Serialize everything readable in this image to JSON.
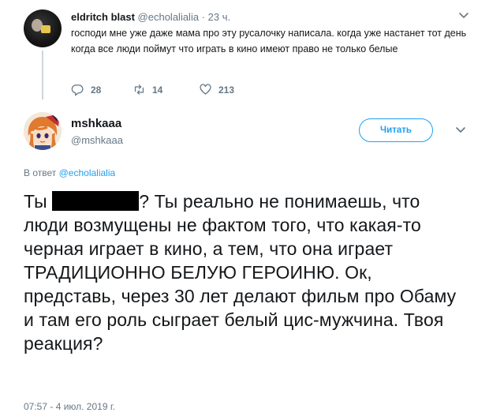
{
  "parent_tweet": {
    "name": "eldritch blast",
    "handle": "@echolalialia",
    "dot": "·",
    "time": "23 ч.",
    "text": "господи мне уже даже мама про эту русалочку написала. когда уже настанет тот день когда все люди поймут что играть в кино имеют право не только белые",
    "actions": {
      "replies": "28",
      "retweets": "14",
      "likes": "213"
    }
  },
  "main_tweet": {
    "name": "mshkaaa",
    "handle": "@mshkaaa",
    "follow_label": "Читать",
    "reply_prefix": "В ответ",
    "reply_to": "@echolalialia",
    "text_before": "Ты",
    "text_after": "? Ты реально не понимаешь, что люди возмущены не фактом того, что какая-то черная играет в кино, а тем, что она играет ТРАДИЦИОННО БЕЛУЮ ГЕРОИНЮ. Ок, представь, через 30 лет делают фильм про Обаму и там его роль сыграет белый цис-мужчина. Твоя реакция?",
    "timestamp": "07:57 - 4 июл. 2019 г."
  },
  "colors": {
    "accent": "#1da1f2",
    "muted": "#657786",
    "text": "#14171a",
    "divider": "#ccd6dd"
  }
}
